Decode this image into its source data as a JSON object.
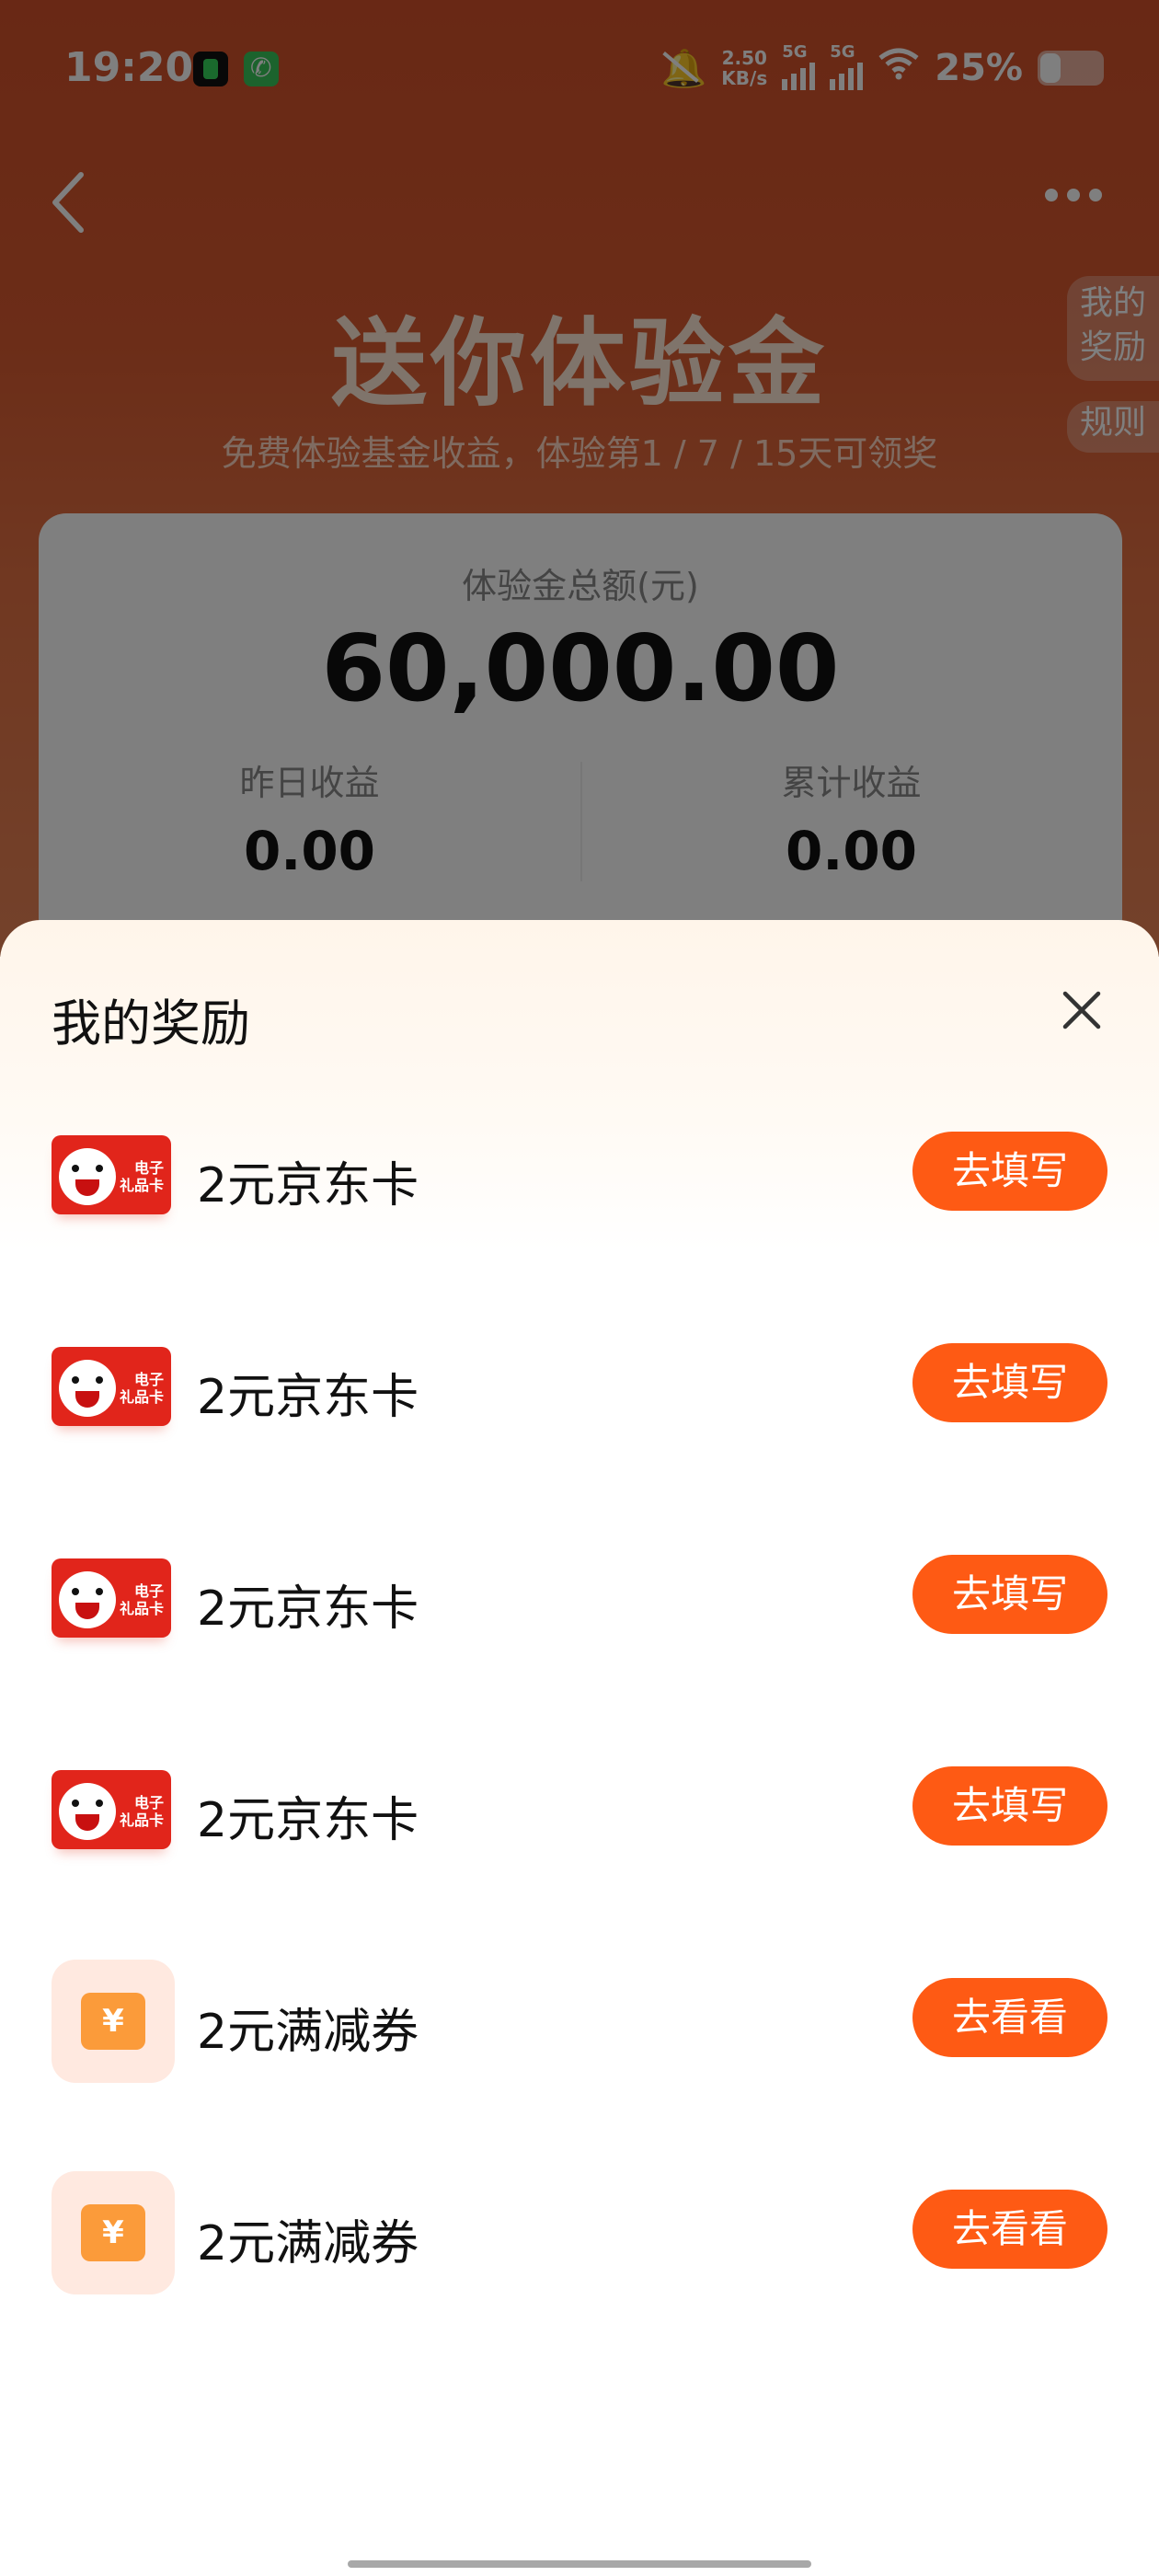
{
  "status_bar": {
    "time": "19:20",
    "net_speed_value": "2.50",
    "net_speed_unit": "KB/s",
    "signal1_label": "5G",
    "signal2_label": "5G",
    "battery": "25%"
  },
  "page": {
    "title": "送你体验金",
    "subtitle": "免费体验基金收益，体验第1 / 7 / 15天可领奖",
    "side_tags": [
      "我的\n奖励",
      "规则"
    ],
    "summary": {
      "total_label": "体验金总额(元)",
      "total_value": "60,000.00",
      "yesterday_label": "昨日收益",
      "yesterday_value": "0.00",
      "cumulative_label": "累计收益",
      "cumulative_value": "0.00"
    }
  },
  "sheet": {
    "title": "我的奖励",
    "items": [
      {
        "type": "jd-card",
        "name": "2元京东卡",
        "action": "去填写"
      },
      {
        "type": "jd-card",
        "name": "2元京东卡",
        "action": "去填写"
      },
      {
        "type": "jd-card",
        "name": "2元京东卡",
        "action": "去填写"
      },
      {
        "type": "jd-card",
        "name": "2元京东卡",
        "action": "去填写"
      },
      {
        "type": "coupon",
        "name": "2元满减券",
        "action": "去看看"
      },
      {
        "type": "coupon",
        "name": "2元满减券",
        "action": "去看看"
      }
    ],
    "jd_card_text": "电子\n礼品卡",
    "coupon_symbol": "¥"
  },
  "colors": {
    "accent": "#fe5a14",
    "header_bg": "#d85a30",
    "coupon_icon": "#fb9b3a"
  }
}
